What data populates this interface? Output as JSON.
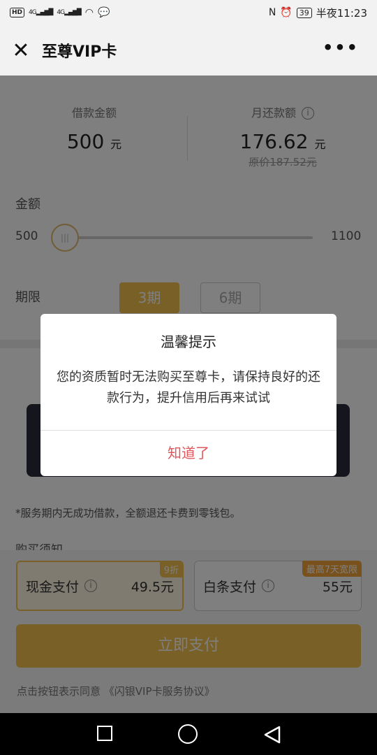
{
  "statusbar": {
    "left_badges": [
      "HD",
      "4G",
      "4G"
    ],
    "right": {
      "nfc": "N",
      "alarm": "⏰",
      "battery": "39",
      "time": "半夜11:23"
    }
  },
  "header": {
    "title": "至尊VIP卡",
    "close_icon": "close-icon",
    "more_icon": "more-icon"
  },
  "summary": {
    "loan_label": "借款金额",
    "loan_value": "500",
    "loan_unit": "元",
    "monthly_label": "月还款额",
    "monthly_value": "176.62",
    "monthly_unit": "元",
    "original_price": "原价187.52元"
  },
  "amount": {
    "label": "金额",
    "min": "500",
    "max": "1100",
    "thumb_glyph": "|||"
  },
  "term": {
    "label": "期限",
    "options": [
      "3期",
      "6期"
    ],
    "selected": "3期"
  },
  "notice": "*服务期内无成功借款，全额退还卡费到零钱包。",
  "purchase_label": "购买须知",
  "payment": {
    "cash": {
      "name": "现金支付",
      "price": "49.5元",
      "tag": "9折"
    },
    "credit": {
      "name": "白条支付",
      "price": "55元",
      "tag": "最高7天宽限"
    },
    "pay_button": "立即支付",
    "agreement": "点击按钮表示同意 《闪银VIP卡服务协议》"
  },
  "dialog": {
    "title": "温馨提示",
    "message": "您的资质暂时无法购买至尊卡，请保持良好的还款行为，提升信用后再来试试",
    "button": "知道了"
  },
  "colors": {
    "accent": "#f3c04f",
    "dialog_button": "#e0575b"
  }
}
